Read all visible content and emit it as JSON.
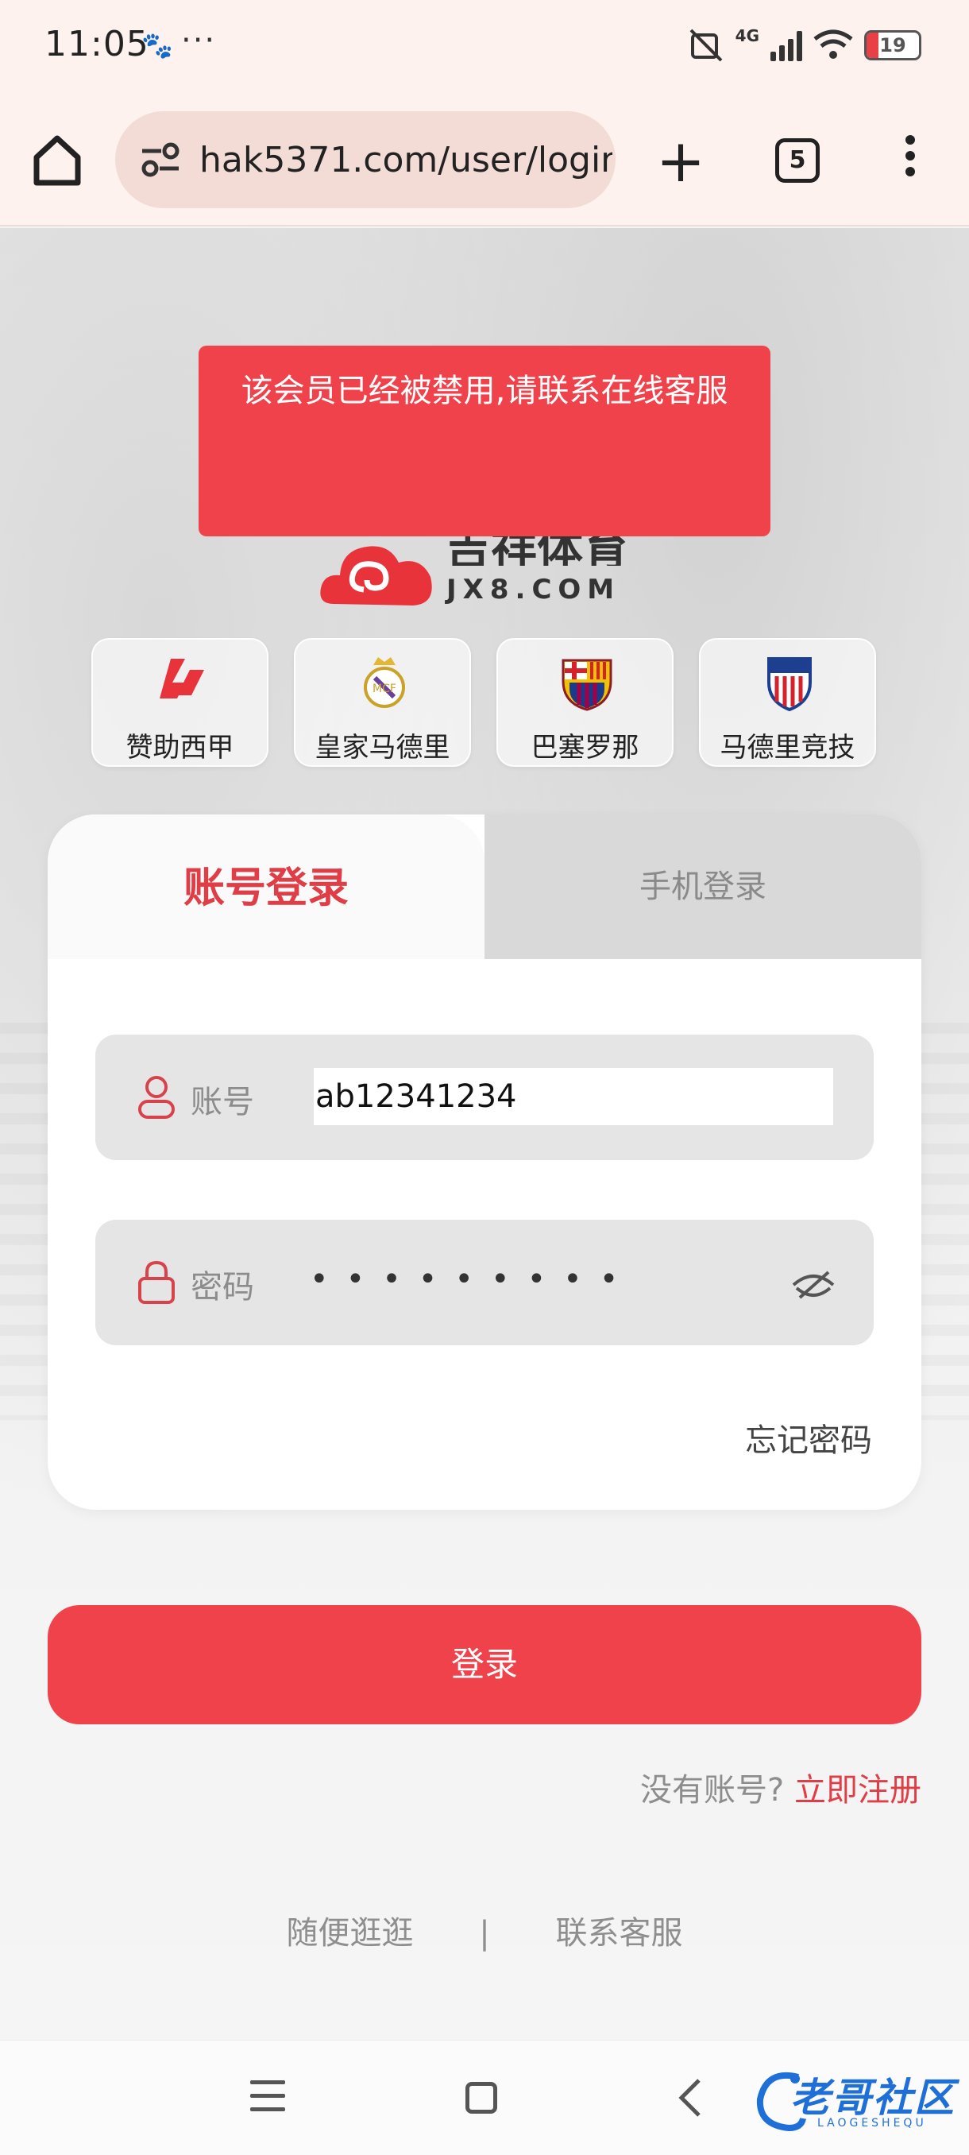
{
  "status_bar": {
    "time": "11:05",
    "dots": "···",
    "network": "4G",
    "battery": "19"
  },
  "browser": {
    "url": "hak5371.com/user/login",
    "tab_count": "5"
  },
  "toast": {
    "message": "该会员已经被禁用,请联系在线客服"
  },
  "brand": {
    "name_cn": "吉祥体育",
    "name_en": "JX8.COM"
  },
  "clubs": [
    {
      "label": "赞助西甲",
      "icon": "laliga-icon"
    },
    {
      "label": "皇家马德里",
      "icon": "real-madrid-crest"
    },
    {
      "label": "巴塞罗那",
      "icon": "barcelona-crest"
    },
    {
      "label": "马德里竞技",
      "icon": "atletico-crest"
    }
  ],
  "login": {
    "tabs": [
      {
        "label": "账号登录",
        "active": true
      },
      {
        "label": "手机登录",
        "active": false
      }
    ],
    "account_label": "账号",
    "account_value": "ab12341234",
    "password_label": "密码",
    "password_mask": "•••••••••",
    "forgot": "忘记密码",
    "submit": "登录",
    "no_account": "没有账号?",
    "register": "立即注册"
  },
  "footer": {
    "browse": "随便逛逛",
    "separator": "|",
    "support": "联系客服"
  },
  "watermark": {
    "text": "老哥社区",
    "sub": "LAOGESHEQU"
  },
  "colors": {
    "accent": "#f0424b",
    "accent_text": "#e03e46",
    "chrome_bg": "#fdf2ee"
  }
}
